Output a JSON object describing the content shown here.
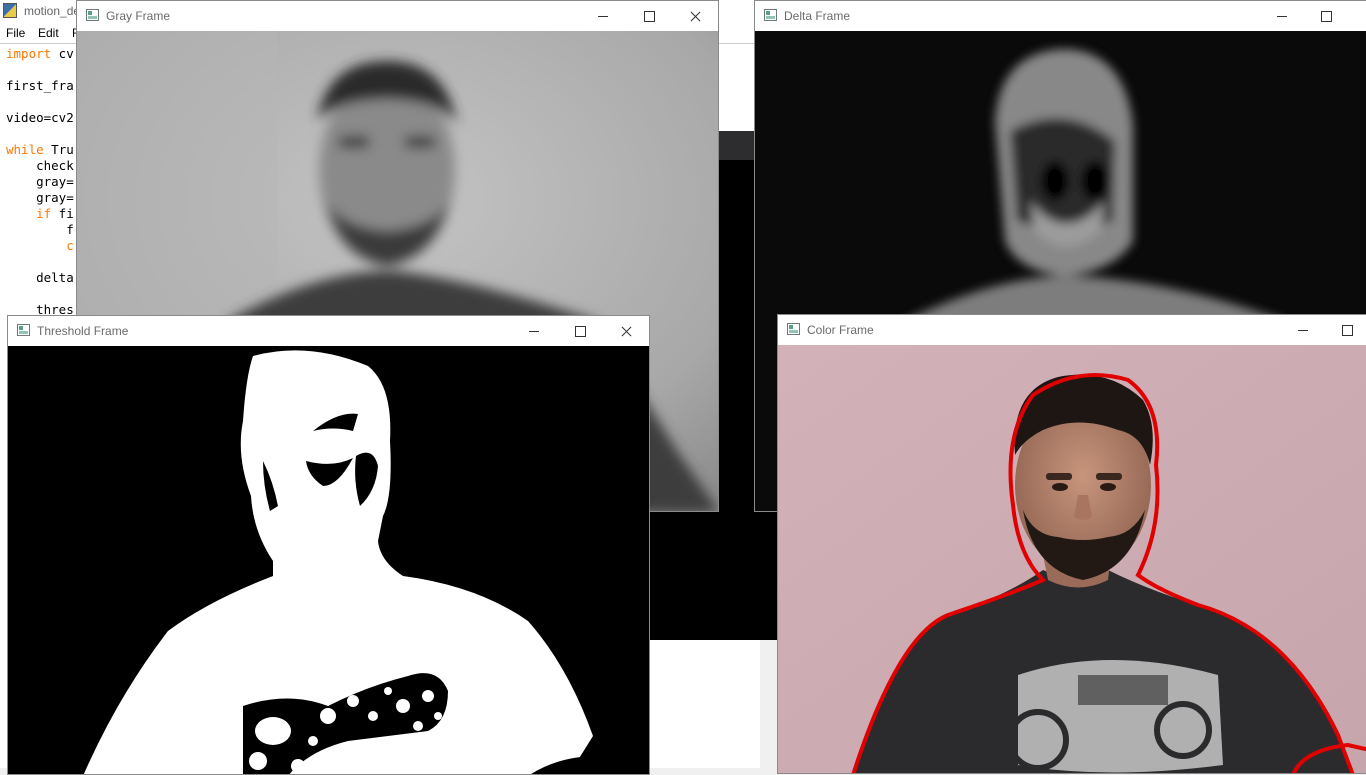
{
  "editor": {
    "title": "motion_de",
    "menu": [
      "File",
      "Edit",
      "F"
    ],
    "code_lines": [
      {
        "kw": "import",
        "rest": " cv"
      },
      {
        "kw": "",
        "rest": "first_fra"
      },
      {
        "kw": "",
        "rest": "video=cv2"
      },
      {
        "kw": "while",
        "rest": " Tru"
      },
      {
        "kw": "",
        "rest": "    check"
      },
      {
        "kw": "",
        "rest": "    gray="
      },
      {
        "kw": "",
        "rest": "    gray="
      },
      {
        "kw": "    if",
        "rest": " fi"
      },
      {
        "kw": "",
        "rest": "        f"
      },
      {
        "kw": "        c",
        "rest": ""
      },
      {
        "kw": "",
        "rest": "    delta"
      },
      {
        "kw": "",
        "rest": "    thres"
      }
    ]
  },
  "windows": {
    "gray": {
      "title": "Gray Frame"
    },
    "delta": {
      "title": "Delta Frame"
    },
    "threshold": {
      "title": "Threshold Frame"
    },
    "color": {
      "title": "Color Frame"
    }
  },
  "colors": {
    "contour": "#e00000",
    "wall_pink": "#c9aab0"
  }
}
